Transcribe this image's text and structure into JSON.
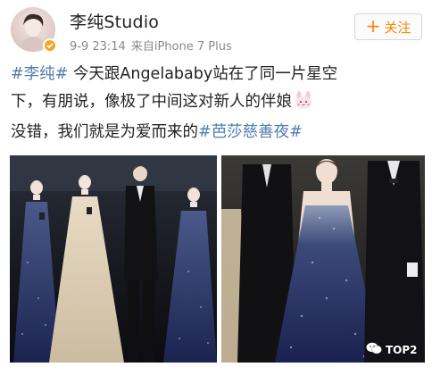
{
  "post": {
    "author": "李纯Studio",
    "timestamp": "9-9 23:14",
    "source": "来自iPhone 7 Plus",
    "follow_label": "关注",
    "follow_plus": "+",
    "text": {
      "l1_tag": "#李纯#",
      "l1_text": " 今天跟Angelababy站在了同一片星空",
      "l2_text": "下，有朋说，像极了中间这对新人的伴娘",
      "l3_text": "没错，我们就是为爱而来的",
      "l3_tag": "#芭莎慈善夜#"
    },
    "emoji": "bunny-emoji"
  },
  "watermark": {
    "label": "TOP2",
    "icon": "wechat-icon"
  },
  "colors": {
    "hashtag": "#507daf",
    "follow_text": "#ff8200",
    "verified_badge": "#f5a623",
    "meta_text": "#8a8a8a"
  }
}
